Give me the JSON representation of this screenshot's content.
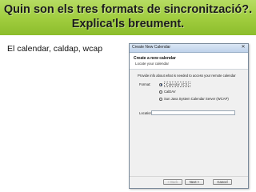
{
  "slide": {
    "title_line1": "Quin son els tres formats de sincronització?.",
    "title_line2": "Explica'ls breument.",
    "bullet": "El calendar, caldap, wcap"
  },
  "dialog": {
    "window_title": "Create New Calendar",
    "close_glyph": "✕",
    "header_title": "Create a new calendar",
    "header_subtitle": "Locate your calendar",
    "info_text": "Provide info about what is needed to access your remote calendar",
    "format_label": "Format:",
    "formats": [
      {
        "label": "iCalendar (ICS)",
        "selected": true
      },
      {
        "label": "CalDAV",
        "selected": false
      },
      {
        "label": "Sun Java System Calendar Server (WCAP)",
        "selected": false
      }
    ],
    "location_label": "Location:",
    "location_value": "",
    "back_label": "< Back",
    "next_label": "Next >",
    "cancel_label": "Cancel"
  }
}
